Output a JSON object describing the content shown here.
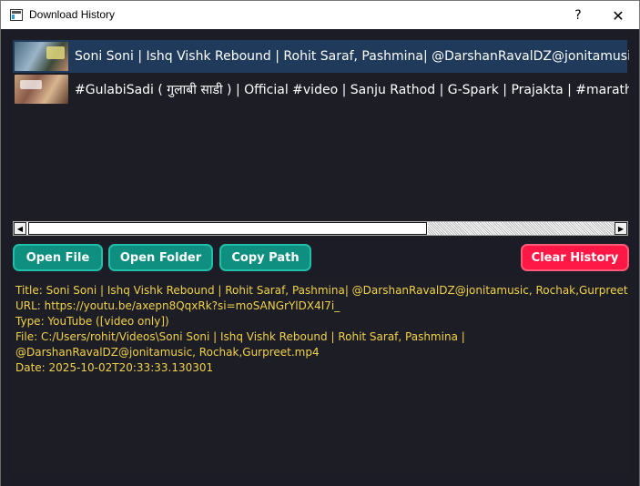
{
  "window": {
    "title": "Download History",
    "help_label": "?",
    "close_label": "✕"
  },
  "history": {
    "items": [
      {
        "title": "Soni Soni | Ishq Vishk Rebound | Rohit Saraf, Pashmina| @DarshanRavalDZ@jonitamusic, Rochak,Gurpreet",
        "selected": true
      },
      {
        "title": "#GulabiSadi ( गुलाबी साडी ) | Official #video | Sanju Rathod | G-Spark | Prajakta | #marathi Song",
        "selected": false
      }
    ]
  },
  "scrollbar": {
    "left_arrow": "◀",
    "right_arrow": "▶"
  },
  "actions": {
    "open_file": "Open File",
    "open_folder": "Open Folder",
    "copy_path": "Copy Path",
    "clear_history": "Clear History"
  },
  "details": {
    "title_line": "Title: Soni Soni | Ishq Vishk Rebound | Rohit Saraf, Pashmina| @DarshanRavalDZ@jonitamusic, Rochak,Gurpreet",
    "url_line": "URL: https://youtu.be/axepn8QqxRk?si=moSANGrYlDX4I7i_",
    "type_line": "Type: YouTube ([video only])",
    "file_line_1": "File: C:/Users/rohit/Videos\\Soni Soni  |  Ishq Vishk Rebound  |  Rohit Saraf, Pashmina |",
    "file_line_2": "@DarshanRavalDZ@jonitamusic, Rochak,Gurpreet.mp4",
    "date_line": "Date: 2025-10-02T20:33:33.130301"
  },
  "colors": {
    "accent_teal": "#0f8f7f",
    "danger_red": "#ff1846",
    "detail_text": "#f2d24a",
    "selection": "#1f3a5a"
  }
}
